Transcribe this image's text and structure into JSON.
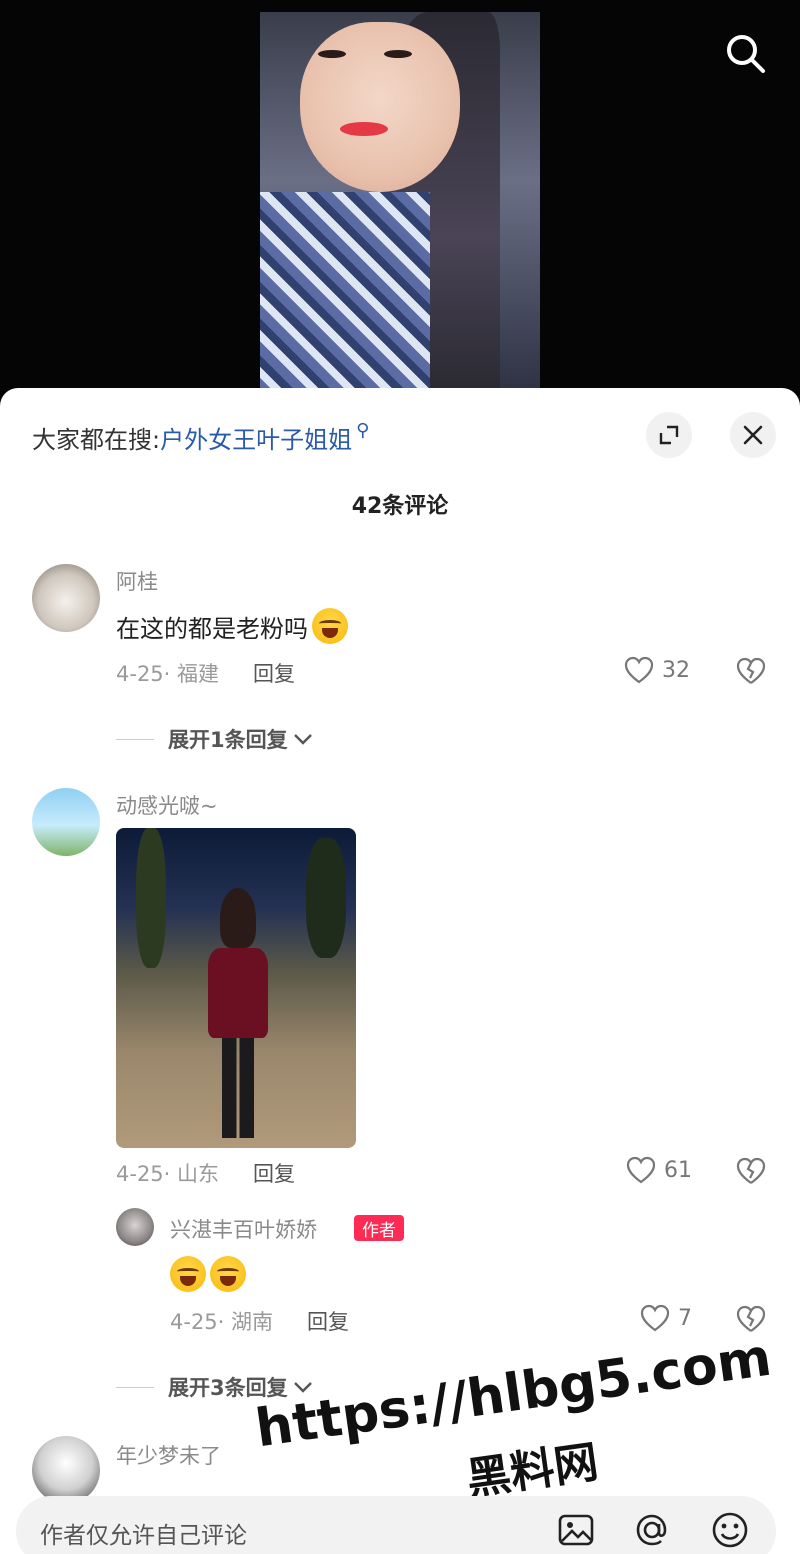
{
  "top_bar": {
    "search_icon": "search-icon"
  },
  "sheet": {
    "trending_prefix": "大家都在搜:",
    "trending_keyword": "户外女王叶子姐姐",
    "comment_count": "42条评论"
  },
  "comments": [
    {
      "username": "阿桂",
      "text": "在这的都是老粉吗",
      "date_region": "4-25· 福建",
      "reply": "回复",
      "likes": "32",
      "expand": "展开1条回复"
    },
    {
      "username": "动感光啵~",
      "date_region": "4-25· 山东",
      "reply": "回复",
      "likes": "61",
      "sub_reply": {
        "username": "兴湛丰百叶娇娇",
        "badge": "作者",
        "date_region": "4-25· 湖南",
        "reply": "回复",
        "likes": "7"
      },
      "expand": "展开3条回复"
    },
    {
      "username": "年少梦未了"
    }
  ],
  "watermark": {
    "url": "https://hlbg5.com",
    "name": "黑料网"
  },
  "bottom_bar": {
    "placeholder": "作者仅允许自己评论"
  }
}
